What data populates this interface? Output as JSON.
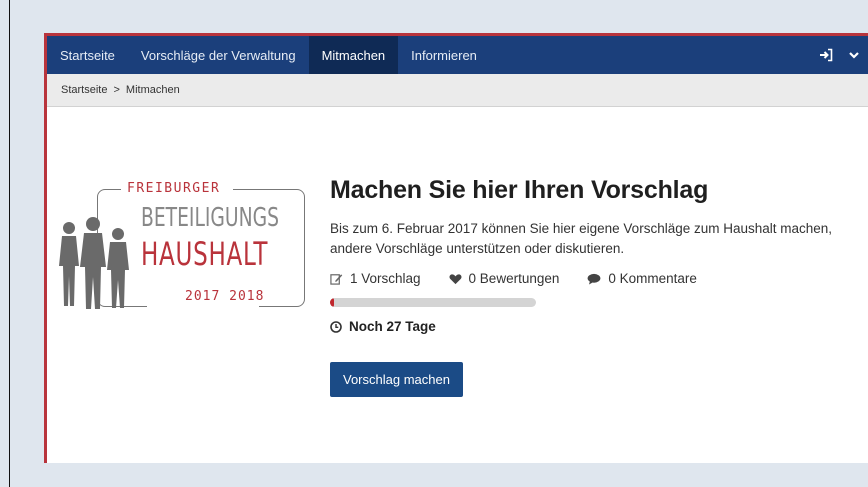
{
  "nav": {
    "items": [
      {
        "label": "Startseite",
        "active": false
      },
      {
        "label": "Vorschläge der Verwaltung",
        "active": false
      },
      {
        "label": "Mitmachen",
        "active": true
      },
      {
        "label": "Informieren",
        "active": false
      }
    ],
    "login_icon": "sign-in-icon",
    "menu_icon": "chevron-down-icon"
  },
  "breadcrumb": {
    "home": "Startseite",
    "separator": ">",
    "current": "Mitmachen"
  },
  "logo": {
    "line1": "FREIBURGER",
    "line2": "BETEILIGUNGS",
    "line3": "HAUSHALT",
    "line4": "2017 2018"
  },
  "content": {
    "headline": "Machen Sie hier Ihren Vorschlag",
    "description": "Bis zum 6. Februar 2017 können Sie hier eigene Vorschläge zum Haushalt machen, andere Vorschläge unterstützen oder diskutieren.",
    "stats": {
      "proposals": "1 Vorschlag",
      "ratings": "0 Bewertungen",
      "comments": "0 Kommentare"
    },
    "progress_percent": 2,
    "days_left": "Noch 27 Tage",
    "cta_label": "Vorschlag machen"
  },
  "colors": {
    "navbar": "#1b3f7b",
    "frame_border": "#b8343c",
    "logo_red": "#b9333b",
    "button": "#1b4b86",
    "progress_fill": "#c0272d"
  }
}
